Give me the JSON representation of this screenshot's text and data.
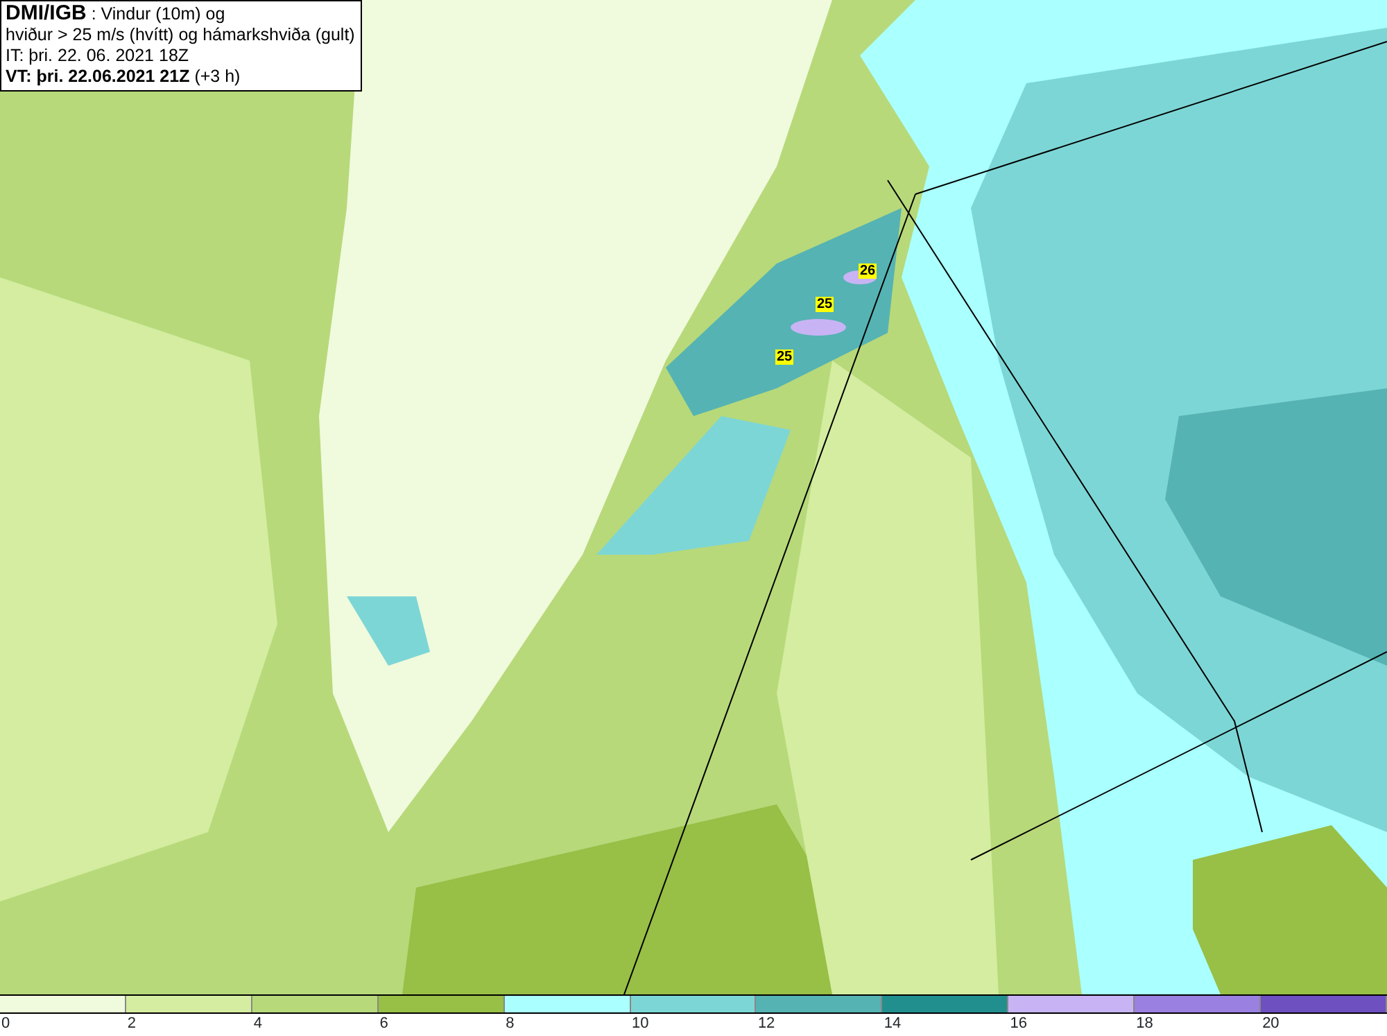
{
  "legend": {
    "source": "DMI/IGB",
    "lines": [
      ": Vindur (10m) og",
      "hviður > 25 m/s (hvítt) og hámarkshviða (gult)",
      "IT: þri. 22. 06. 2021 18Z"
    ],
    "valid_time": "VT: þri. 22.06.2021 21Z",
    "lead": "(+3 h)"
  },
  "map": {
    "gust_labels": [
      "26",
      "25",
      "25"
    ]
  },
  "colorbar": {
    "swatches": [
      {
        "color": "#f0fadc"
      },
      {
        "color": "#d4eda0"
      },
      {
        "color": "#b7d97a"
      },
      {
        "color": "#98bf46"
      },
      {
        "color": "#aaffff"
      },
      {
        "color": "#7dd6d6"
      },
      {
        "color": "#56b3b3"
      },
      {
        "color": "#228f8f"
      },
      {
        "color": "#c8b4f5"
      },
      {
        "color": "#9a80e0"
      },
      {
        "color": "#6e50c0"
      }
    ],
    "ticks": [
      "0",
      "2",
      "4",
      "6",
      "8",
      "10",
      "12",
      "14",
      "16",
      "18",
      "20"
    ]
  }
}
